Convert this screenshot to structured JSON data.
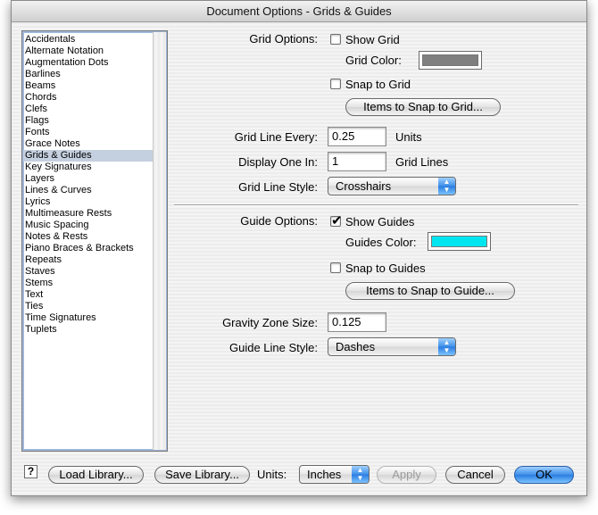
{
  "window": {
    "title": "Document Options - Grids & Guides"
  },
  "categories": [
    "Accidentals",
    "Alternate Notation",
    "Augmentation Dots",
    "Barlines",
    "Beams",
    "Chords",
    "Clefs",
    "Flags",
    "Fonts",
    "Grace Notes",
    "Grids & Guides",
    "Key Signatures",
    "Layers",
    "Lines & Curves",
    "Lyrics",
    "Multimeasure Rests",
    "Music Spacing",
    "Notes & Rests",
    "Piano Braces & Brackets",
    "Repeats",
    "Staves",
    "Stems",
    "Text",
    "Ties",
    "Time Signatures",
    "Tuplets"
  ],
  "selected_category": "Grids & Guides",
  "grid": {
    "options_label": "Grid Options:",
    "show_label": "Show Grid",
    "show_checked": false,
    "color_label": "Grid Color:",
    "color": "#7f7f7f",
    "snap_label": "Snap to Grid",
    "snap_checked": false,
    "items_button": "Items to Snap to Grid...",
    "line_every_label": "Grid Line Every:",
    "line_every_value": "0.25",
    "line_every_unit": "Units",
    "display_label": "Display One In:",
    "display_value": "1",
    "display_unit": "Grid Lines",
    "style_label": "Grid Line Style:",
    "style_value": "Crosshairs"
  },
  "guide": {
    "options_label": "Guide Options:",
    "show_label": "Show Guides",
    "show_checked": true,
    "color_label": "Guides Color:",
    "color": "#00e6f0",
    "snap_label": "Snap to Guides",
    "snap_checked": false,
    "items_button": "Items to Snap to Guide...",
    "gravity_label": "Gravity Zone Size:",
    "gravity_value": "0.125",
    "style_label": "Guide Line Style:",
    "style_value": "Dashes"
  },
  "footer": {
    "help": "?",
    "load_library": "Load Library...",
    "save_library": "Save Library...",
    "units_label": "Units:",
    "units_value": "Inches",
    "apply": "Apply",
    "cancel": "Cancel",
    "ok": "OK"
  }
}
